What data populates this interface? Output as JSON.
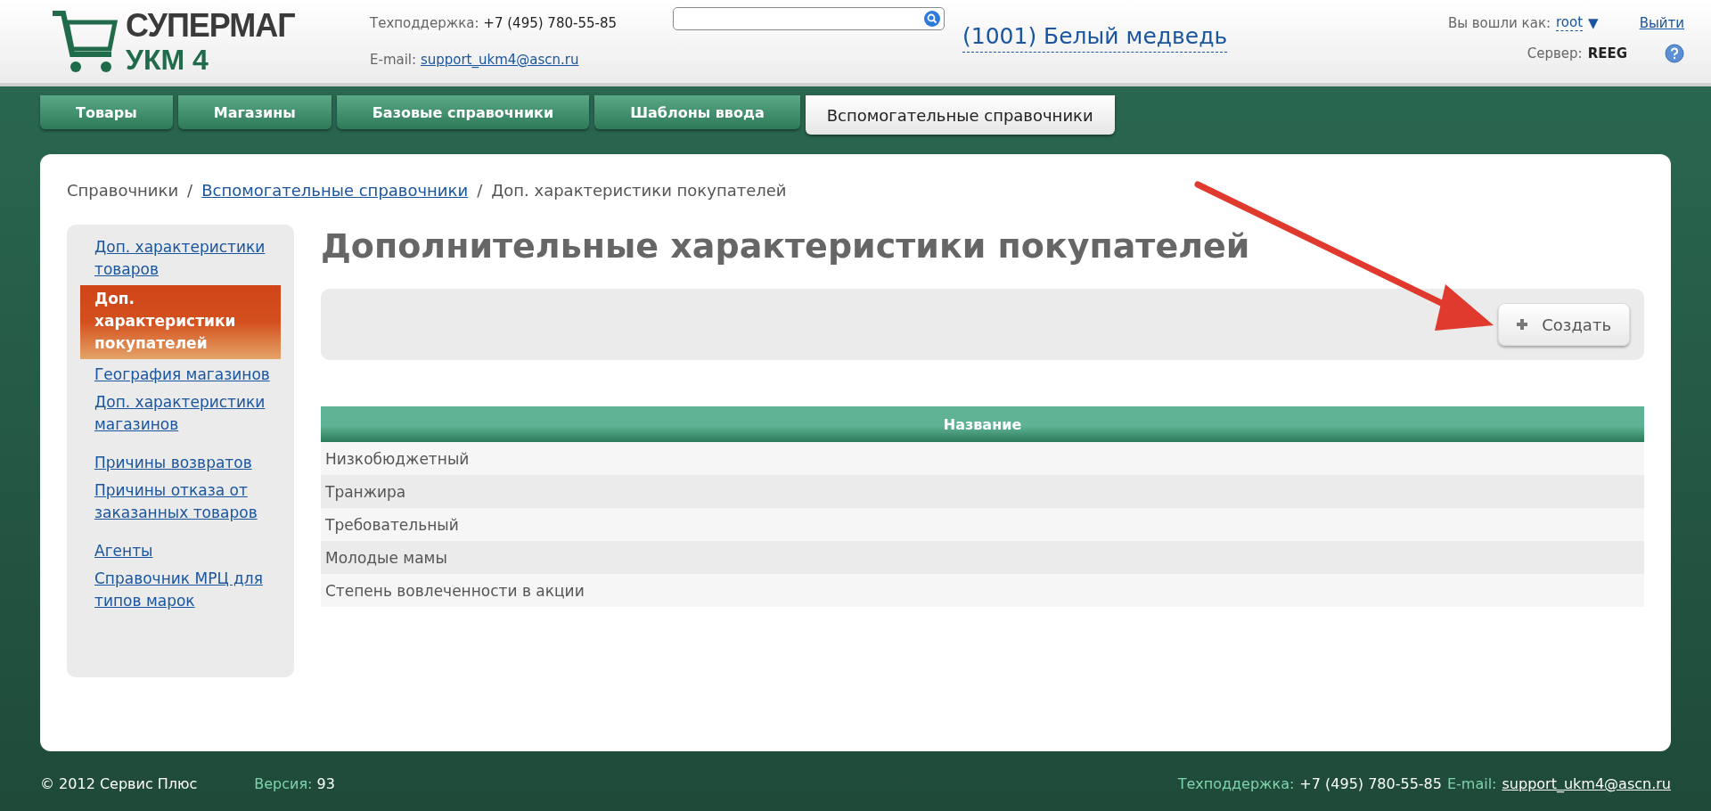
{
  "header": {
    "logo": {
      "line1": "СУПЕРМАГ",
      "line2": "УКМ 4"
    },
    "support": {
      "label": "Техподдержка:",
      "phone": "+7 (495) 780-55-85",
      "email_label": "E-mail:",
      "email": "support_ukm4@ascn.ru"
    },
    "store": "(1001) Белый медведь",
    "user": {
      "label": "Вы вошли как:",
      "name": "root",
      "caret": "▼",
      "logout": "Выйти",
      "server_label": "Сервер:",
      "server": "REEG"
    }
  },
  "tabs": [
    {
      "label": "Товары",
      "selected": false
    },
    {
      "label": "Магазины",
      "selected": false
    },
    {
      "label": "Базовые справочники",
      "selected": false
    },
    {
      "label": "Шаблоны ввода",
      "selected": false
    },
    {
      "label": "Вспомогательные справочники",
      "selected": true
    }
  ],
  "breadcrumbs": [
    {
      "kind": "text",
      "label": "Справочники"
    },
    {
      "kind": "separator",
      "label": "/"
    },
    {
      "kind": "link",
      "label": "Вспомогательные справочники"
    },
    {
      "kind": "separator",
      "label": "/"
    },
    {
      "kind": "text",
      "label": "Доп. характеристики покупателей"
    }
  ],
  "sidebar": {
    "items": [
      {
        "label": "Доп. характеристики товаров",
        "selected": false
      },
      {
        "label": "Доп. характеристики покупателей",
        "selected": true
      },
      {
        "label": "География магазинов",
        "selected": false
      },
      {
        "label": "Доп. характеристики магазинов",
        "selected": false
      },
      {
        "label": "Причины возвратов",
        "selected": false
      },
      {
        "label": "Причины отказа от заказанных товаров",
        "selected": false
      },
      {
        "label": "Агенты",
        "selected": false
      },
      {
        "label": "Справочник МРЦ для типов марок",
        "selected": false
      }
    ]
  },
  "page_title": "Дополнительные характеристики покупателей",
  "toolbar": {
    "create_button": "Создать"
  },
  "table": {
    "columns": [
      "Название"
    ],
    "rows": [
      [
        "Низкобюджетный"
      ],
      [
        "Транжира"
      ],
      [
        "Требовательный"
      ],
      [
        "Молодые мамы"
      ],
      [
        "Степень вовлеченности в акции"
      ]
    ]
  },
  "footer": {
    "copyright": "© 2012 Сервис Плюс",
    "version_label": "Версия:",
    "version": "93",
    "support_label": "Техподдержка:",
    "phone": "+7 (495) 780-55-85",
    "email_label": "E-mail:",
    "email": "support_ukm4@ascn.ru"
  }
}
